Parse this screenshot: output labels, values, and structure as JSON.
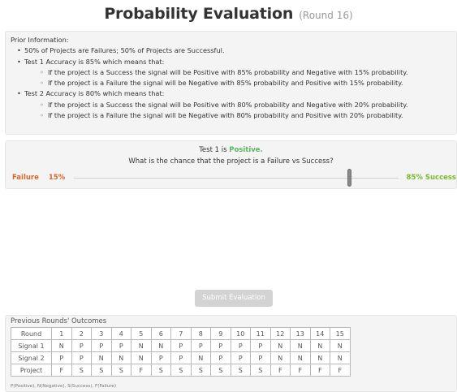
{
  "header": {
    "title": "Probability Evaluation",
    "round": "(Round 16)"
  },
  "prior": {
    "heading": "Prior Information:",
    "items": [
      {
        "text": "50% of Projects are Failures; 50% of Projects are Successful."
      },
      {
        "text": "Test 1 Accuracy is 85% which means that:",
        "sub": [
          "If the project is a Success the signal will be Positive with 85% probability and Negative with 15% probability.",
          "If the project is a Failure the signal will be Negative with 85% probability and Positive with 15% probability."
        ]
      },
      {
        "text": "Test 2 Accuracy is 80% which means that:",
        "sub": [
          "If the project is a Success the signal will be Positive with 80% probability and Negative with 20% probability.",
          "If the project is a Failure the signal will be Negative with 80% probability and Positive with 20% probability."
        ]
      }
    ]
  },
  "evaluation": {
    "test_label": "Test 1 is",
    "test_result": "Positive.",
    "question": "What is the chance that the project is a Failure vs Success?",
    "failure_label": "Failure",
    "failure_pct": "15%",
    "success_label": "85% Success",
    "slider_fraction": 0.85,
    "result_color": "#5cb85c",
    "failure_color": "#d9662a",
    "success_color": "#7ab92a"
  },
  "submit": {
    "label": "Submit Evaluation"
  },
  "previous": {
    "title": "Previous Rounds' Outcomes",
    "rows": [
      {
        "label": "Round",
        "cells": [
          "1",
          "2",
          "3",
          "4",
          "5",
          "6",
          "7",
          "8",
          "9",
          "10",
          "11",
          "12",
          "13",
          "14",
          "15"
        ]
      },
      {
        "label": "Signal 1",
        "cells": [
          "N",
          "P",
          "P",
          "P",
          "N",
          "N",
          "P",
          "P",
          "P",
          "P",
          "P",
          "N",
          "N",
          "N",
          "N"
        ]
      },
      {
        "label": "Signal 2",
        "cells": [
          "P",
          "P",
          "N",
          "N",
          "N",
          "P",
          "P",
          "N",
          "P",
          "P",
          "P",
          "N",
          "N",
          "N",
          "N"
        ]
      },
      {
        "label": "Project",
        "cells": [
          "F",
          "S",
          "S",
          "S",
          "F",
          "S",
          "S",
          "S",
          "S",
          "S",
          "S",
          "F",
          "F",
          "F",
          "F"
        ]
      }
    ],
    "legend": "P(Positive), N(Negative), S(Success), F(Failure)"
  }
}
